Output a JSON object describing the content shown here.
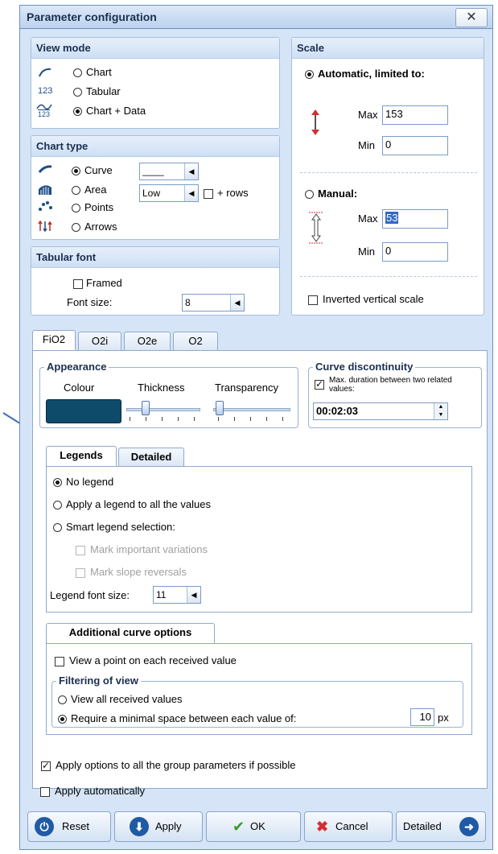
{
  "window": {
    "title": "Parameter configuration",
    "close_label": "✕"
  },
  "view_mode": {
    "header": "View mode",
    "options": [
      {
        "label": "Chart",
        "icon": "chart-curve-icon",
        "icon_text": "",
        "selected": false
      },
      {
        "label": "Tabular",
        "icon": "numbers-123-icon",
        "icon_text": "123",
        "selected": false
      },
      {
        "label": "Chart + Data",
        "icon": "chart-data-icon",
        "icon_text": "123",
        "selected": true
      }
    ]
  },
  "chart_type": {
    "header": "Chart type",
    "options": [
      {
        "label": "Curve",
        "icon": "curve-icon",
        "selected": true
      },
      {
        "label": "Area",
        "icon": "area-icon",
        "selected": false
      },
      {
        "label": "Points",
        "icon": "points-icon",
        "selected": false
      },
      {
        "label": "Arrows",
        "icon": "arrows-icon",
        "selected": false
      }
    ],
    "line_style_value": "____",
    "area_value": "Low",
    "rows_label": "+ rows"
  },
  "tabular_font": {
    "header": "Tabular font",
    "framed_label": "Framed",
    "font_size_label": "Font size:",
    "font_size_value": "8"
  },
  "scale": {
    "header": "Scale",
    "automatic_label": "Automatic, limited to:",
    "auto_max_label": "Max",
    "auto_max_value": "153",
    "auto_min_label": "Min",
    "auto_min_value": "0",
    "manual_label": "Manual:",
    "manual_max_label": "Max",
    "manual_max_value": "53",
    "manual_min_label": "Min",
    "manual_min_value": "0",
    "inverted_label": "Inverted vertical scale"
  },
  "tabs": [
    {
      "label": "FiO2",
      "selected": true
    },
    {
      "label": "O2i",
      "selected": false
    },
    {
      "label": "O2e",
      "selected": false
    },
    {
      "label": "O2",
      "selected": false
    }
  ],
  "appearance": {
    "title": "Appearance",
    "colour_label": "Colour",
    "thickness_label": "Thickness",
    "transparency_label": "Transparency",
    "colour_value": "#0e4a6a"
  },
  "curve_discontinuity": {
    "title": "Curve discontinuity",
    "max_duration_label": "Max. duration between two related values:",
    "duration_value": "00:02:03"
  },
  "legends": {
    "tab_legends": "Legends",
    "tab_detailed": "Detailed",
    "no_legend": "No legend",
    "apply_all": "Apply a legend to all the values",
    "smart": "Smart legend selection:",
    "mark_variations": "Mark important variations",
    "mark_slope": "Mark slope reversals",
    "font_size_label": "Legend font size:",
    "font_size_value": "11"
  },
  "additional": {
    "tab_label": "Additional curve options",
    "view_point_label": "View a point on each received value",
    "filtering_title": "Filtering of view",
    "view_all_label": "View all received values",
    "min_space_label": "Require a minimal space between each value of:",
    "min_space_value": "10",
    "unit": "px"
  },
  "options": {
    "apply_group": "Apply options to all the group parameters if possible",
    "apply_auto": "Apply automatically"
  },
  "buttons": {
    "reset": "Reset",
    "apply": "Apply",
    "ok": "OK",
    "cancel": "Cancel",
    "detailed": "Detailed"
  }
}
